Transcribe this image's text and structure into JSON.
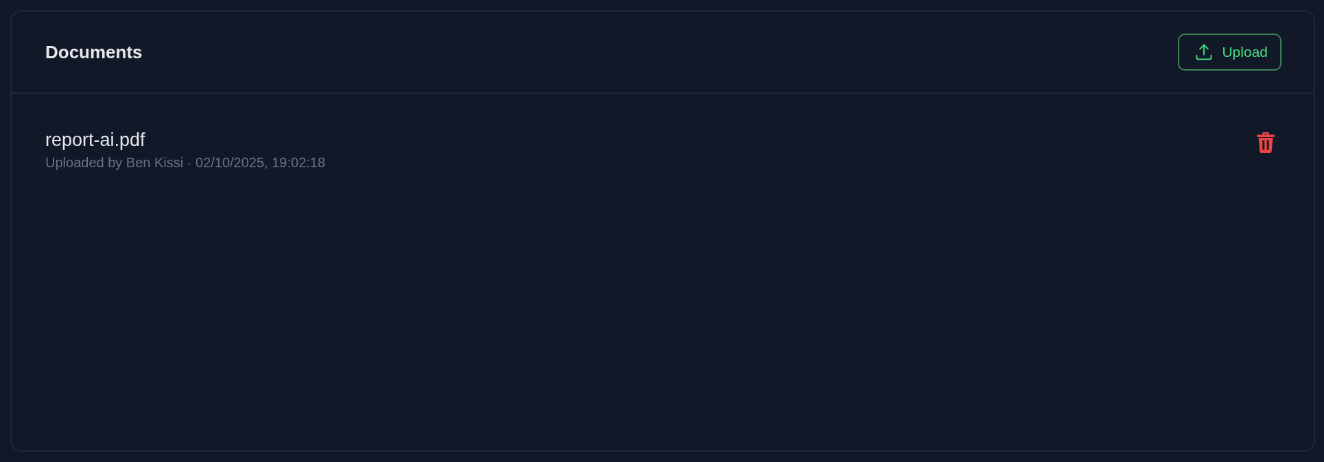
{
  "panel": {
    "title": "Documents",
    "upload_button": {
      "label": "Upload"
    }
  },
  "documents": [
    {
      "name": "report-ai.pdf",
      "meta": "Uploaded by Ben Kissi · 02/10/2025, 19:02:18"
    }
  ]
}
